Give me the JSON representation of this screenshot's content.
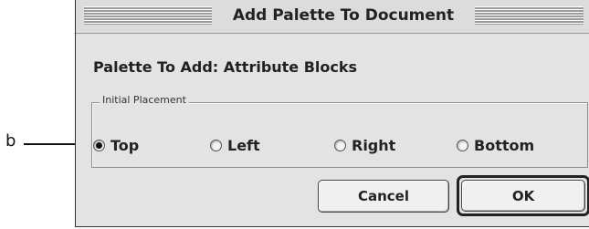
{
  "callout": {
    "label": "b"
  },
  "dialog": {
    "title": "Add Palette To Document",
    "heading": "Palette To Add: Attribute Blocks",
    "group_label": "Initial Placement",
    "options": [
      {
        "label": "Top",
        "checked": true
      },
      {
        "label": "Left",
        "checked": false
      },
      {
        "label": "Right",
        "checked": false
      },
      {
        "label": "Bottom",
        "checked": false
      }
    ],
    "buttons": {
      "cancel": "Cancel",
      "ok": "OK"
    }
  }
}
